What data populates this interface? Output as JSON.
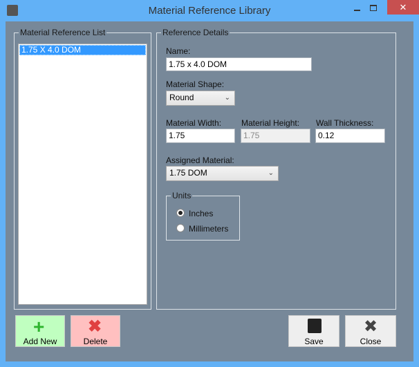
{
  "window": {
    "title": "Material Reference Library"
  },
  "list": {
    "legend": "Material Reference List",
    "items": [
      "1.75 X 4.0 DOM"
    ]
  },
  "details": {
    "legend": "Reference Details",
    "name_label": "Name:",
    "name_value": "1.75 x 4.0 DOM",
    "shape_label": "Material Shape:",
    "shape_value": "Round",
    "width_label": "Material Width:",
    "width_value": "1.75",
    "height_label": "Material Height:",
    "height_value": "1.75",
    "wall_label": "Wall Thickness:",
    "wall_value": "0.12",
    "assigned_label": "Assigned Material:",
    "assigned_value": "1.75 DOM",
    "units": {
      "legend": "Units",
      "options": [
        "Inches",
        "Millimeters"
      ],
      "selected": "Inches"
    }
  },
  "buttons": {
    "add": "Add New",
    "delete": "Delete",
    "save": "Save",
    "close": "Close"
  },
  "colors": {
    "titlebar": "#62b1f6",
    "client": "#778899",
    "selection": "#3399ff",
    "close_btn": "#c75050"
  }
}
